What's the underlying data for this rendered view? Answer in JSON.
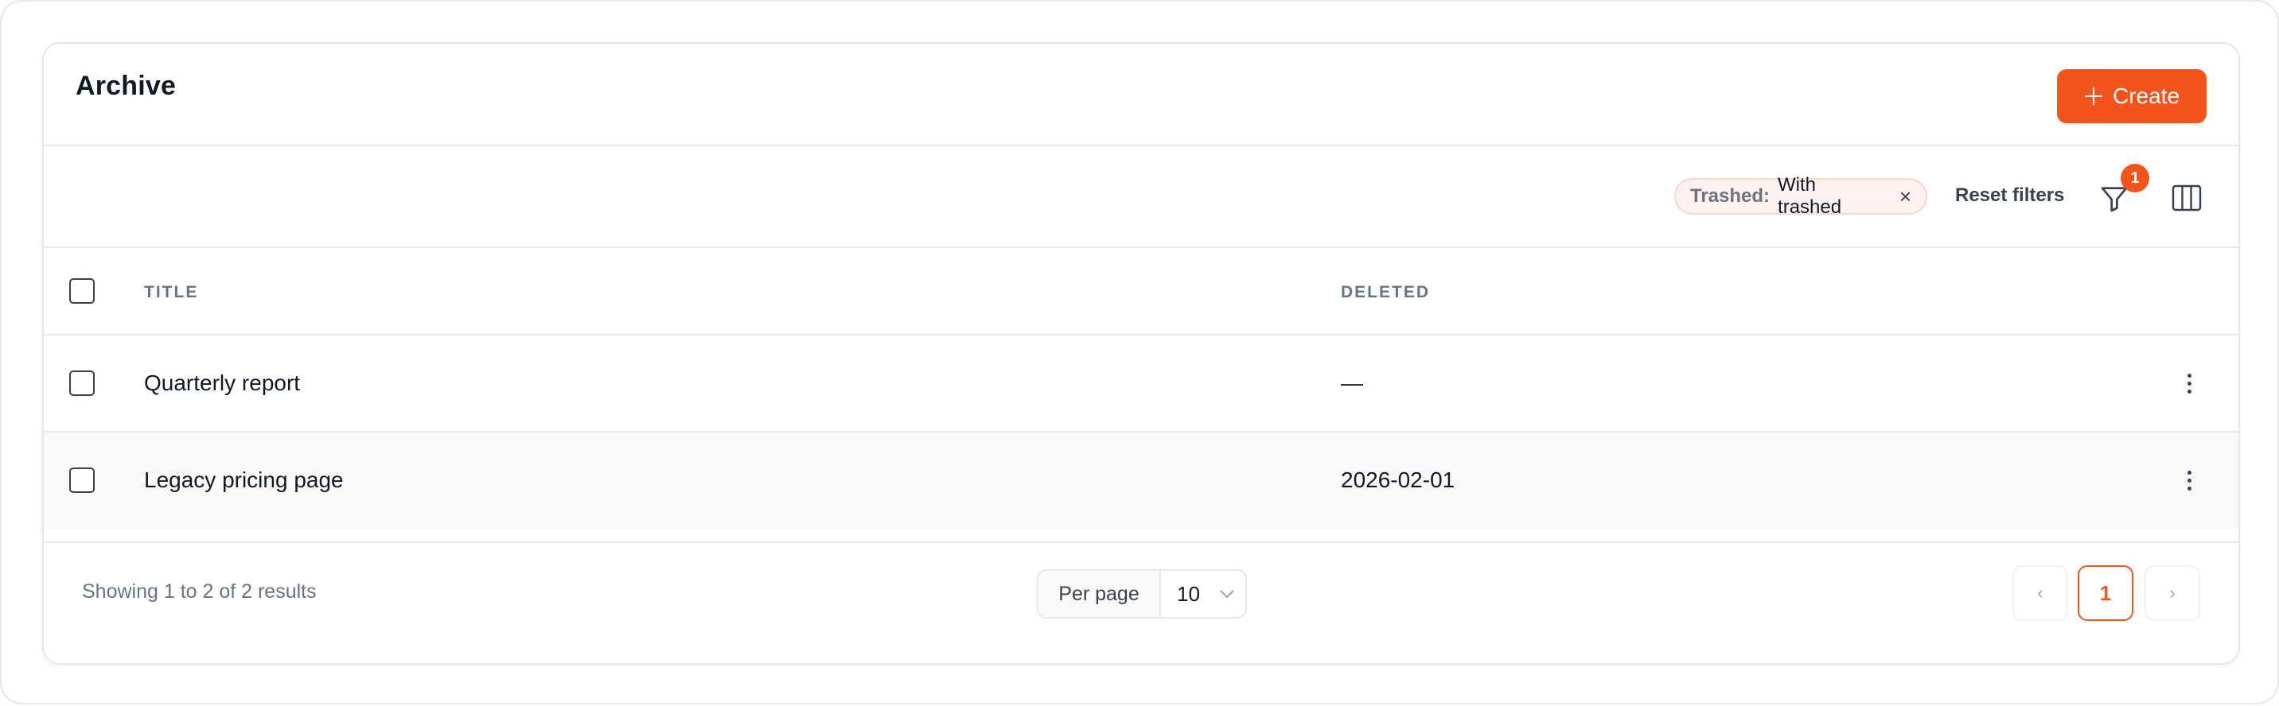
{
  "header": {
    "title": "Archive",
    "create_label": "Create"
  },
  "toolbar": {
    "filter_chip": {
      "key": "Trashed:",
      "value": "With trashed",
      "close": "×"
    },
    "reset_filters_label": "Reset filters",
    "filter_count": "1"
  },
  "table": {
    "columns": [
      "TITLE",
      "DELETED"
    ],
    "rows": [
      {
        "title": "Quarterly report",
        "deleted": "—"
      },
      {
        "title": "Legacy pricing page",
        "deleted": "2026-02-01"
      }
    ]
  },
  "footer": {
    "showing": "Showing 1 to 2 of 2 results",
    "per_page_label": "Per page",
    "per_page_value": "10",
    "pagination": {
      "prev": "‹",
      "current": "1",
      "next": "›"
    }
  },
  "colors": {
    "accent": "#f3541c",
    "muted_text": "#64748b",
    "border": "#e5e7eb"
  },
  "icons": [
    "plus-icon",
    "close-icon",
    "filter-icon",
    "columns-icon",
    "kebab-icon",
    "chevron-down-icon"
  ]
}
